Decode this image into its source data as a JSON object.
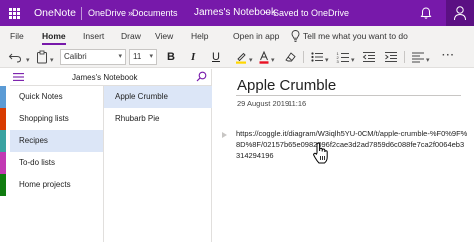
{
  "titlebar": {
    "app_name": "OneNote",
    "breadcrumb_1": "OneDrive",
    "breadcrumb_sep": "»",
    "breadcrumb_2": "Documents",
    "notebook_name": "James's Notebook",
    "dash": "–",
    "save_status": "Saved to OneDrive",
    "bg_color": "#7719aa"
  },
  "ribbon": {
    "tabs": [
      "File",
      "Home",
      "Insert",
      "Draw",
      "View",
      "Help",
      "Open in app"
    ],
    "active_tab": "Home",
    "tell_me": "Tell me what you want to do"
  },
  "toolbar": {
    "font_name": "Calibri",
    "font_size": "11",
    "bold": "B",
    "italic": "I",
    "underline": "U"
  },
  "notebook": {
    "title": "James's Notebook"
  },
  "sections": [
    {
      "label": "Quick Notes",
      "color": "#5b9bd5",
      "selected": false
    },
    {
      "label": "Shopping lists",
      "color": "#d83b01",
      "selected": false
    },
    {
      "label": "Recipes",
      "color": "#3aa3a1",
      "selected": true
    },
    {
      "label": "To-do lists",
      "color": "#c239b3",
      "selected": false
    },
    {
      "label": "Home projects",
      "color": "#107c10",
      "selected": false
    }
  ],
  "pages": [
    {
      "label": "Apple Crumble",
      "selected": true
    },
    {
      "label": "Rhubarb Pie",
      "selected": false
    }
  ],
  "note": {
    "title": "Apple Crumble",
    "date": "29 August 2019",
    "time": "11:16",
    "url": "https://coggle.it/diagram/W3iqlh5YU-0CM/t/apple-crumble-%F0%9F%8D%8F/02157b65e0982096f2cae3d2ad7859d6c088fe7ca2f0064eb3314294196"
  },
  "colors": {
    "accent": "#7719aa",
    "selection": "#dce6f7"
  }
}
